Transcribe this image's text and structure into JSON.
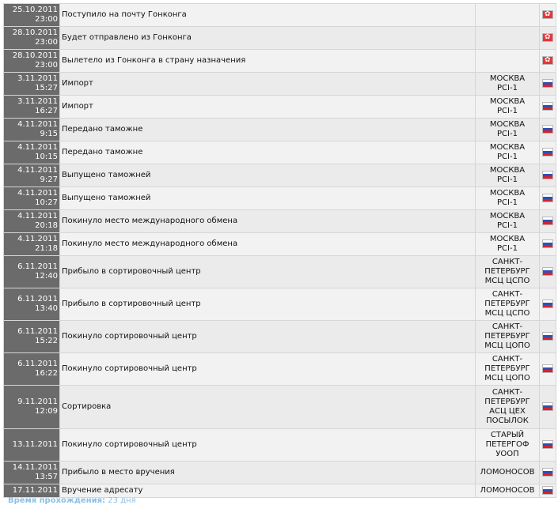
{
  "rows": [
    {
      "date": "25.10.2011",
      "time": "23:00",
      "status": "Поступило на почту Гонконга",
      "place": "",
      "flag": "hk-flag-icon"
    },
    {
      "date": "28.10.2011",
      "time": "23:00",
      "status": "Будет отправлено из Гонконга",
      "place": "",
      "flag": "hk-flag-icon"
    },
    {
      "date": "28.10.2011",
      "time": "23:00",
      "status": "Вылетело из Гонконга в страну назначения",
      "place": "",
      "flag": "hk-flag-icon"
    },
    {
      "date": "3.11.2011",
      "time": "15:27",
      "status": "Импорт",
      "place": "МОСКВА\nPCI-1",
      "flag": "ru-flag-icon"
    },
    {
      "date": "3.11.2011",
      "time": "16:27",
      "status": "Импорт",
      "place": "МОСКВА\nPCI-1",
      "flag": "ru-flag-icon"
    },
    {
      "date": "4.11.2011",
      "time": "9:15",
      "status": "Передано таможне",
      "place": "МОСКВА\nPCI-1",
      "flag": "ru-flag-icon"
    },
    {
      "date": "4.11.2011",
      "time": "10:15",
      "status": "Передано таможне",
      "place": "МОСКВА\nPCI-1",
      "flag": "ru-flag-icon"
    },
    {
      "date": "4.11.2011",
      "time": "9:27",
      "status": "Выпущено таможней",
      "place": "МОСКВА\nPCI-1",
      "flag": "ru-flag-icon"
    },
    {
      "date": "4.11.2011",
      "time": "10:27",
      "status": "Выпущено таможней",
      "place": "МОСКВА\nPCI-1",
      "flag": "ru-flag-icon"
    },
    {
      "date": "4.11.2011",
      "time": "20:18",
      "status": "Покинуло место международного обмена",
      "place": "МОСКВА\nPCI-1",
      "flag": "ru-flag-icon"
    },
    {
      "date": "4.11.2011",
      "time": "21:18",
      "status": "Покинуло место международного обмена",
      "place": "МОСКВА\nPCI-1",
      "flag": "ru-flag-icon"
    },
    {
      "date": "6.11.2011",
      "time": "12:40",
      "status": "Прибыло в сортировочный центр",
      "place": "САНКТ-\nПЕТЕРБУРГ\nМСЦ ЦСПО",
      "flag": "ru-flag-icon"
    },
    {
      "date": "6.11.2011",
      "time": "13:40",
      "status": "Прибыло в сортировочный центр",
      "place": "САНКТ-\nПЕТЕРБУРГ\nМСЦ ЦСПО",
      "flag": "ru-flag-icon"
    },
    {
      "date": "6.11.2011",
      "time": "15:22",
      "status": "Покинуло сортировочный центр",
      "place": "САНКТ-\nПЕТЕРБУРГ\nМСЦ ЦОПО",
      "flag": "ru-flag-icon"
    },
    {
      "date": "6.11.2011",
      "time": "16:22",
      "status": "Покинуло сортировочный центр",
      "place": "САНКТ-\nПЕТЕРБУРГ\nМСЦ ЦОПО",
      "flag": "ru-flag-icon"
    },
    {
      "date": "9.11.2011",
      "time": "12:09",
      "status": "Сортировка",
      "place": "САНКТ-\nПЕТЕРБУРГ\nАСЦ ЦЕХ\nПОСЫЛОК",
      "flag": "ru-flag-icon"
    },
    {
      "date": "13.11.2011",
      "time": "",
      "status": "Покинуло сортировочный центр",
      "place": "СТАРЫЙ\nПЕТЕРГОФ\nУООП",
      "flag": "ru-flag-icon"
    },
    {
      "date": "14.11.2011",
      "time": "13:57",
      "status": "Прибыло в место вручения",
      "place": "ЛОМОНОСОВ",
      "flag": "ru-flag-icon"
    },
    {
      "date": "17.11.2011",
      "time": "",
      "status": "Вручение адресату",
      "place": "ЛОМОНОСОВ",
      "flag": "ru-flag-icon"
    }
  ],
  "footer": {
    "label": "Время прохождения:",
    "value": "23 дня"
  },
  "colors": {
    "date_cell_bg": "#6b6b6b",
    "row_bg": "#f2f2f2",
    "row_bg_alt": "#ebebeb",
    "footer_text": "#8bbfe4"
  }
}
